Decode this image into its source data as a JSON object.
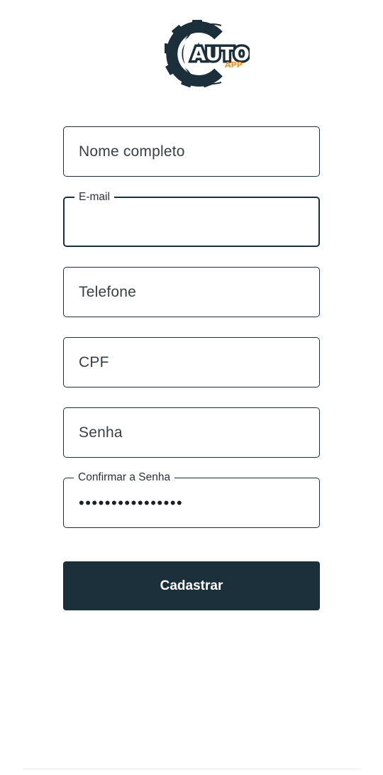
{
  "logo": {
    "word": "AUTO",
    "subword": "APP",
    "colors": {
      "dark": "#1b2f3b",
      "accent": "#f0922e"
    }
  },
  "form": {
    "nome": {
      "placeholder": "Nome completo"
    },
    "email": {
      "label": "E-mail",
      "value": ""
    },
    "telefone": {
      "placeholder": "Telefone"
    },
    "cpf": {
      "placeholder": "CPF"
    },
    "senha": {
      "placeholder": "Senha"
    },
    "confirmar": {
      "label": "Confirmar a Senha",
      "value": "••••••••••••••••"
    }
  },
  "submit_label": "Cadastrar"
}
